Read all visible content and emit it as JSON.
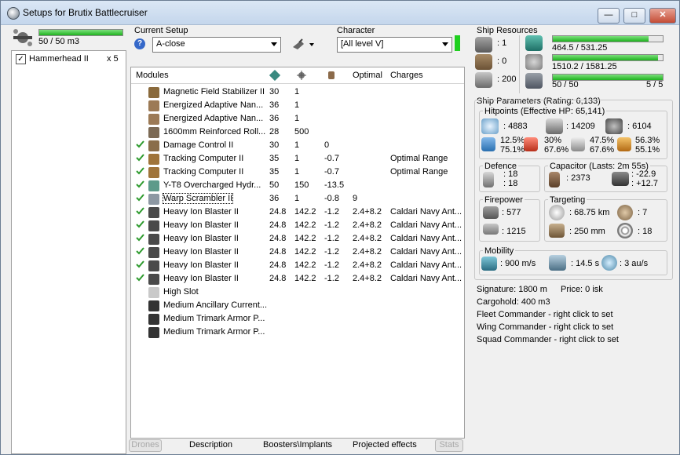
{
  "window": {
    "title": "Setups for Brutix Battlecruiser",
    "buttons": [
      "—",
      "□",
      "✕"
    ]
  },
  "left": {
    "drones_bar_text": "50 / 50 m3",
    "drones_fill": 1.0,
    "drone_items": [
      {
        "name": "Hammerhead II",
        "qty": "x 5",
        "checked": true
      }
    ]
  },
  "setup": {
    "label": "Current Setup",
    "value": "A-close"
  },
  "character": {
    "label": "Character",
    "value": "[All level V]"
  },
  "modules": {
    "headers": [
      "Modules",
      "",
      "",
      "",
      "Optimal",
      "Charges"
    ],
    "rows": [
      {
        "name": "Magnetic Field Stabilizer II",
        "c1": "30",
        "c2": "1",
        "c3": "",
        "optimal": "",
        "charges": "",
        "check": false,
        "icon": "#8a6a3c"
      },
      {
        "name": "Energized Adaptive Nan...",
        "c1": "36",
        "c2": "1",
        "c3": "",
        "optimal": "",
        "charges": "",
        "check": false,
        "icon": "#9c7a56"
      },
      {
        "name": "Energized Adaptive Nan...",
        "c1": "36",
        "c2": "1",
        "c3": "",
        "optimal": "",
        "charges": "",
        "check": false,
        "icon": "#9c7a56"
      },
      {
        "name": "1600mm Reinforced Roll...",
        "c1": "28",
        "c2": "500",
        "c3": "",
        "optimal": "",
        "charges": "",
        "check": false,
        "icon": "#7c6a55"
      },
      {
        "name": "Damage Control II",
        "c1": "30",
        "c2": "1",
        "c3": "0",
        "optimal": "",
        "charges": "",
        "check": true,
        "icon": "#8a6d4a"
      },
      {
        "name": "Tracking Computer II",
        "c1": "35",
        "c2": "1",
        "c3": "-0.7",
        "optimal": "",
        "charges": "Optimal Range",
        "check": true,
        "icon": "#a0743a"
      },
      {
        "name": "Tracking Computer II",
        "c1": "35",
        "c2": "1",
        "c3": "-0.7",
        "optimal": "",
        "charges": "Optimal Range",
        "check": true,
        "icon": "#a0743a"
      },
      {
        "name": "Y-T8 Overcharged Hydr...",
        "c1": "50",
        "c2": "150",
        "c3": "-13.5",
        "optimal": "",
        "charges": "",
        "check": true,
        "icon": "#5e9a8a"
      },
      {
        "name": "Warp Scrambler II",
        "c1": "36",
        "c2": "1",
        "c3": "-0.8",
        "optimal": "9",
        "charges": "",
        "check": true,
        "icon": "#8d98a3"
      },
      {
        "name": "Heavy Ion Blaster II",
        "c1": "24.8",
        "c2": "142.2",
        "c3": "-1.2",
        "optimal": "2.4+8.2",
        "charges": "Caldari Navy Ant...",
        "check": true,
        "icon": "#4a4a4a"
      },
      {
        "name": "Heavy Ion Blaster II",
        "c1": "24.8",
        "c2": "142.2",
        "c3": "-1.2",
        "optimal": "2.4+8.2",
        "charges": "Caldari Navy Ant...",
        "check": true,
        "icon": "#4a4a4a"
      },
      {
        "name": "Heavy Ion Blaster II",
        "c1": "24.8",
        "c2": "142.2",
        "c3": "-1.2",
        "optimal": "2.4+8.2",
        "charges": "Caldari Navy Ant...",
        "check": true,
        "icon": "#4a4a4a"
      },
      {
        "name": "Heavy Ion Blaster II",
        "c1": "24.8",
        "c2": "142.2",
        "c3": "-1.2",
        "optimal": "2.4+8.2",
        "charges": "Caldari Navy Ant...",
        "check": true,
        "icon": "#4a4a4a"
      },
      {
        "name": "Heavy Ion Blaster II",
        "c1": "24.8",
        "c2": "142.2",
        "c3": "-1.2",
        "optimal": "2.4+8.2",
        "charges": "Caldari Navy Ant...",
        "check": true,
        "icon": "#4a4a4a"
      },
      {
        "name": "Heavy Ion Blaster II",
        "c1": "24.8",
        "c2": "142.2",
        "c3": "-1.2",
        "optimal": "2.4+8.2",
        "charges": "Caldari Navy Ant...",
        "check": true,
        "icon": "#4a4a4a"
      },
      {
        "name": "High Slot",
        "c1": "",
        "c2": "",
        "c3": "",
        "optimal": "",
        "charges": "",
        "check": false,
        "icon": "#c9c9c9"
      },
      {
        "name": "Medium Ancillary Current...",
        "c1": "",
        "c2": "",
        "c3": "",
        "optimal": "",
        "charges": "",
        "check": false,
        "icon": "#333333"
      },
      {
        "name": "Medium Trimark Armor P...",
        "c1": "",
        "c2": "",
        "c3": "",
        "optimal": "",
        "charges": "",
        "check": false,
        "icon": "#333333"
      },
      {
        "name": "Medium Trimark Armor P...",
        "c1": "",
        "c2": "",
        "c3": "",
        "optimal": "",
        "charges": "",
        "check": false,
        "icon": "#333333"
      }
    ]
  },
  "tabs": [
    "Drones",
    "Description",
    "Boosters\\Implants",
    "Projected effects",
    "Stats"
  ],
  "resources": {
    "title": "Ship Resources",
    "turrets": ": 1",
    "launchers": ": 0",
    "calibration": ": 200",
    "cpu_text": "464.5 / 531.25",
    "cpu_fill": 0.874,
    "pg_text": "1510.2 / 1581.25",
    "pg_fill": 0.955,
    "drone_bw_text": "50 / 50",
    "drone_active_text": "5 / 5",
    "drone_bw_fill": 1.0
  },
  "params": {
    "title": "Ship Parameters (Rating: 6,133)",
    "hp_title": "Hitpoints (Effective HP: 65,141)",
    "shield_hp": ": 4883",
    "armor_hp": ": 14209",
    "hull_hp": ": 6104",
    "res1_a": "12.5%",
    "res1_b": "75.1%",
    "res2_a": "30%",
    "res2_b": "67.6%",
    "res3_a": "47.5%",
    "res3_b": "67.6%",
    "res4_a": "56.3%",
    "res4_b": "55.1%",
    "defence_title": "Defence",
    "defence_a": ": 18",
    "defence_b": ": 18",
    "capacitor_title": "Capacitor (Lasts: 2m 55s)",
    "cap_amount": ": 2373",
    "cap_a": ": -22.9",
    "cap_b": ": +12.7",
    "firepower_title": "Firepower",
    "dps": ": 577",
    "volley": ": 1215",
    "targeting_title": "Targeting",
    "target_range": ": 68.75 km",
    "max_targets": ": 7",
    "scan_res": ": 250 mm",
    "sensor": ": 18",
    "mobility_title": "Mobility",
    "speed": ": 900 m/s",
    "align": ": 14.5 s",
    "warp": ": 3 au/s",
    "signature": "Signature: 1800 m",
    "price": "Price: 0 isk",
    "cargohold": "Cargohold: 400 m3",
    "fleet": "Fleet Commander - right click to set",
    "wing": "Wing Commander - right click to set",
    "squad": "Squad Commander - right click to set"
  }
}
